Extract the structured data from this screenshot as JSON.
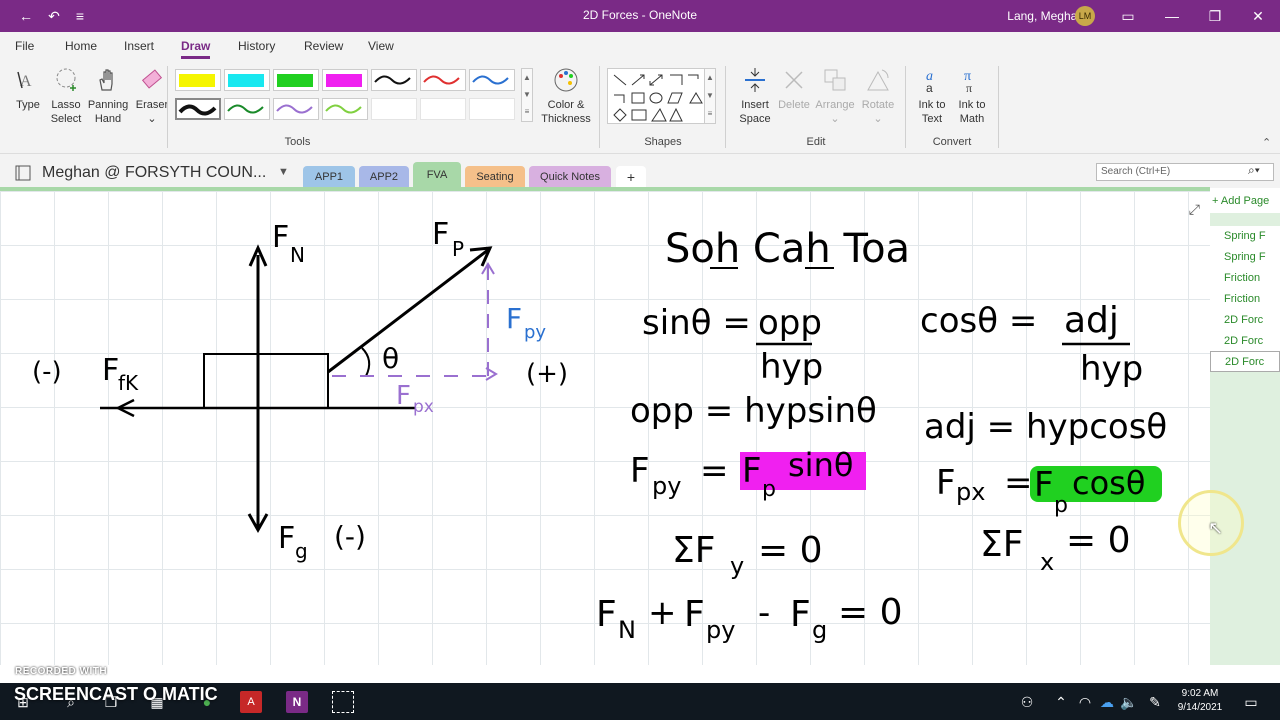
{
  "titlebar": {
    "title": "2D Forces - OneNote",
    "user": "Lang, Meghan",
    "avatar": "LM"
  },
  "menu": [
    "File",
    "Home",
    "Insert",
    "Draw",
    "History",
    "Review",
    "View"
  ],
  "ribbon": {
    "type": "Type",
    "lasso": "Lasso\nSelect",
    "lasso_l1": "Lasso",
    "lasso_l2": "Select",
    "panning_l1": "Panning",
    "panning_l2": "Hand",
    "eraser": "Eraser",
    "color_l1": "Color &",
    "color_l2": "Thickness",
    "tools_label": "Tools",
    "shapes_label": "Shapes",
    "insert_l1": "Insert",
    "insert_l2": "Space",
    "delete": "Delete",
    "arrange": "Arrange",
    "rotate": "Rotate",
    "edit_label": "Edit",
    "ink_text_l1": "Ink to",
    "ink_text_l2": "Text",
    "ink_math_l1": "Ink to",
    "ink_math_l2": "Math",
    "convert_label": "Convert",
    "pens_row1": [
      "#f5f500",
      "#18e8f0",
      "#20d020",
      "#f020f0",
      "#111111",
      "#e03030",
      "#2a70d0"
    ],
    "pens_row2": [
      "#111111",
      "#1a8a2a",
      "#9a70d0",
      "#80d040"
    ]
  },
  "notebook": {
    "name": "Meghan @ FORSYTH COUN..."
  },
  "tabs": [
    {
      "label": "APP1",
      "color": "#9ec5e8"
    },
    {
      "label": "APP2",
      "color": "#a8b8e8"
    },
    {
      "label": "FVA",
      "color": "#a8d8a8"
    },
    {
      "label": "Seating",
      "color": "#f5c08a"
    },
    {
      "label": "Quick Notes",
      "color": "#d8b0e0"
    },
    {
      "label": "+",
      "color": "#f3f3f3"
    }
  ],
  "search": {
    "placeholder": "Search (Ctrl+E)"
  },
  "pages_pane": {
    "add_page": "Add Page",
    "items": [
      "Spring F",
      "Spring F",
      "Friction",
      "Friction",
      "2D Forc",
      "2D Forc",
      "2D Forc"
    ]
  },
  "ink": {
    "fn": "F",
    "fn_sub": "N",
    "fp": "F",
    "fp_sub": "P",
    "fpy": "F",
    "fpy_sub": "py",
    "fpx": "F",
    "fpx_sub": "px",
    "ffk": "F",
    "ffk_sub": "fK",
    "fg": "F",
    "fg_sub": "g",
    "neg_left": "(-)",
    "pos_right": "(+)",
    "neg_down": "(-)",
    "theta": "θ",
    "soh": "Soh Cah Toa",
    "sin_eq_left": "sinθ =",
    "sin_num": "opp",
    "sin_den": "hyp",
    "cos_eq_left": "cosθ =",
    "cos_num": "adj",
    "cos_den": "hyp",
    "opp_eq": "opp = hypsinθ",
    "adj_eq": "adj = hypcosθ",
    "fpy_eq_l": "F",
    "fpy_eq_sub": "py",
    "fpy_eq_eq": "=",
    "fpy_eq_r": "F",
    "fpy_eq_rsub": "p",
    "fpy_eq_fn": "sinθ",
    "fpx_eq_l": "F",
    "fpx_eq_sub": "px",
    "fpx_eq_eq": "=",
    "fpx_eq_r": "F",
    "fpx_eq_rsub": "p",
    "fpx_eq_fn": "cosθ",
    "sum_fy_l": "ΣF",
    "sum_fy_sub": "y",
    "sum_fy_r": "= 0",
    "sum_fx_l": "ΣF",
    "sum_fx_sub": "x",
    "sum_fx_r": "= 0",
    "balance_fn": "F",
    "balance_fn_sub": "N",
    "balance_plus": "+",
    "balance_fpy": "F",
    "balance_fpy_sub": "py",
    "balance_minus": "-",
    "balance_fg": "F",
    "balance_fg_sub": "g",
    "balance_eq": "= 0"
  },
  "taskbar": {
    "time": "9:02 AM",
    "date": "9/14/2021"
  },
  "watermark": {
    "small": "RECORDED WITH",
    "big": "SCREENCAST O MATIC"
  },
  "colors": {
    "accent": "#7a2a86",
    "ink_blue": "#2a70d0",
    "ink_purple": "#9a70d0",
    "highlight_magenta": "#f020f0",
    "highlight_green": "#20d020"
  }
}
